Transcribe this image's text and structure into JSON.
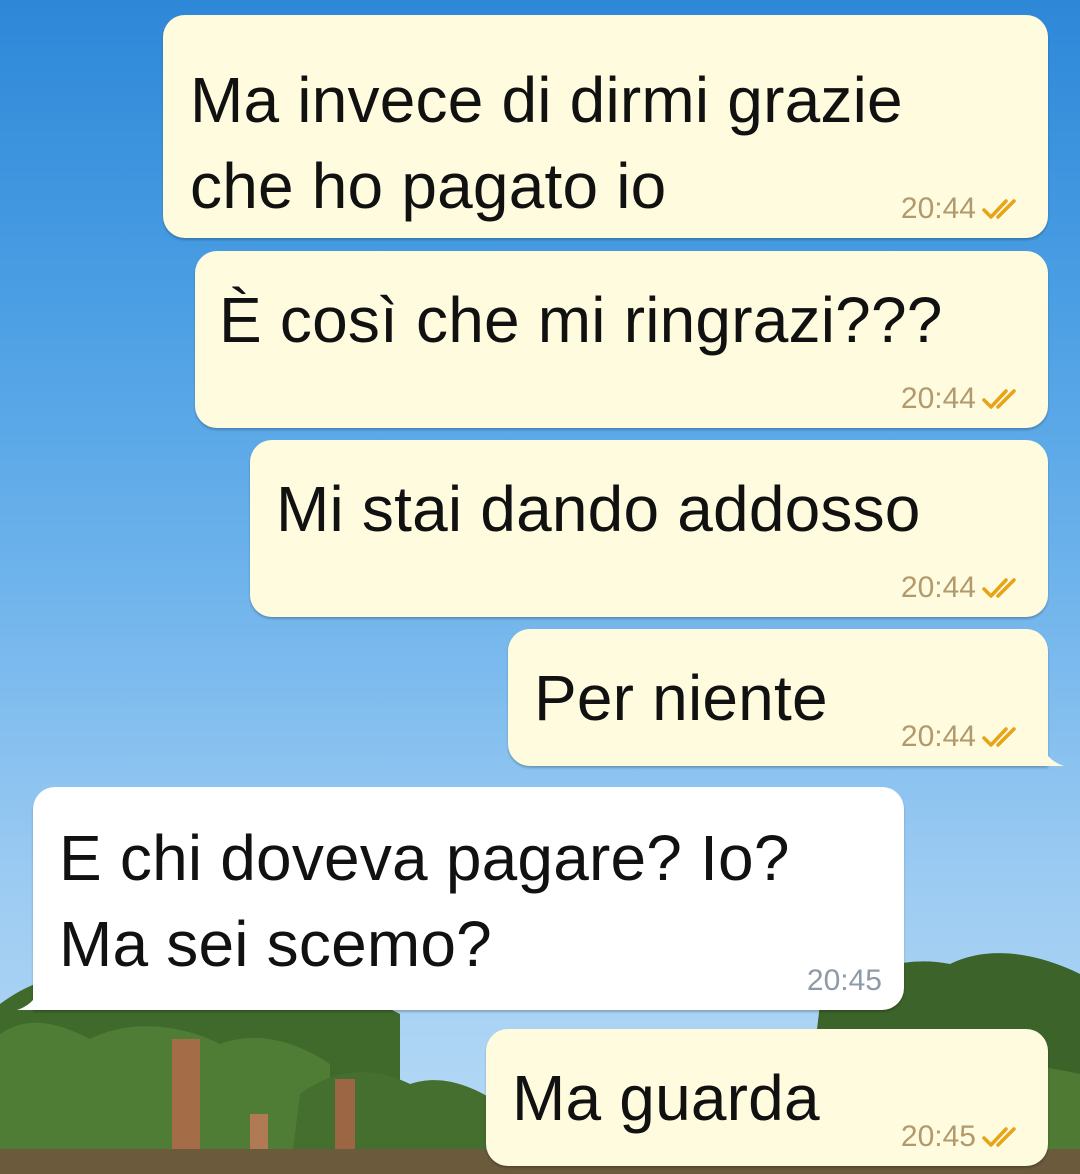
{
  "messages": [
    {
      "text": "Ma invece di dirmi grazie\nche ho pagato io",
      "time": "20:44"
    },
    {
      "text": "È così che mi ringrazi???",
      "time": "20:44"
    },
    {
      "text": "Mi stai dando addosso",
      "time": "20:44"
    },
    {
      "text": "Per niente",
      "time": "20:44"
    },
    {
      "text": "E chi doveva pagare? Io?\nMa sei scemo?",
      "time": "20:45"
    },
    {
      "text": "Ma guarda",
      "time": "20:45"
    }
  ],
  "colors": {
    "outgoing_bubble": "#fefbde",
    "incoming_bubble": "#ffffff",
    "read_ticks": "#e8a317"
  },
  "icons": {
    "read_status": "double-check-icon"
  }
}
